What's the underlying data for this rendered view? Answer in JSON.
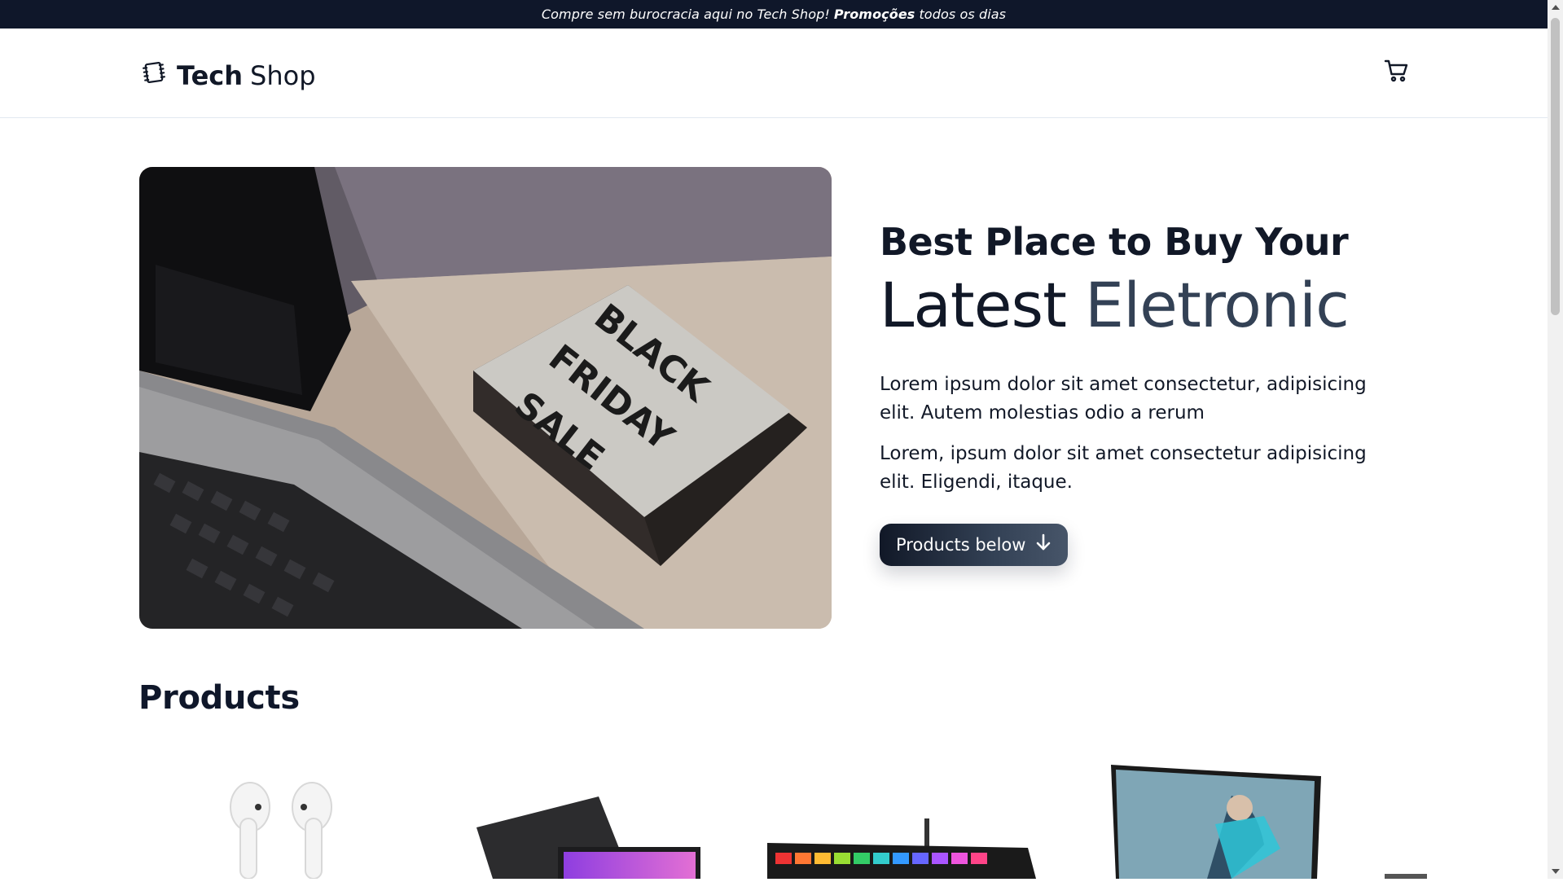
{
  "topbar": {
    "text_before": "Compre sem burocracia aqui no Tech Shop!",
    "text_bold": "Promoções",
    "text_after": "todos os dias"
  },
  "header": {
    "brand_strong": "Tech",
    "brand_light": "Shop",
    "logo_icon": "chip-icon",
    "cart_icon": "shopping-cart-icon"
  },
  "hero": {
    "image_alt": "Laptop next to a lightbox sign",
    "sign_lines": [
      "BLACK",
      "FRIDAY",
      "SALE"
    ],
    "title_line_1": "Best Place to Buy Your",
    "title_word_1": "Latest",
    "title_word_2": "Eletronic",
    "paragraph_1": "Lorem ipsum dolor sit amet consectetur, adipisicing elit. Autem molestias odio a rerum",
    "paragraph_2": "Lorem, ipsum dolor sit amet consectetur adipisicing elit. Eligendi, itaque.",
    "cta_label": "Products below",
    "cta_icon": "arrow-down-icon"
  },
  "products": {
    "title": "Products",
    "items": [
      {
        "image": "airpods-image"
      },
      {
        "image": "laptop-image"
      },
      {
        "image": "keyboard-image"
      },
      {
        "image": "monitor-image"
      }
    ]
  },
  "colors": {
    "topbar_bg": "#0f172a",
    "text_primary": "#111827",
    "accent_text": "#334155",
    "cta_gradient_start": "#111827",
    "cta_gradient_end": "#475569"
  }
}
